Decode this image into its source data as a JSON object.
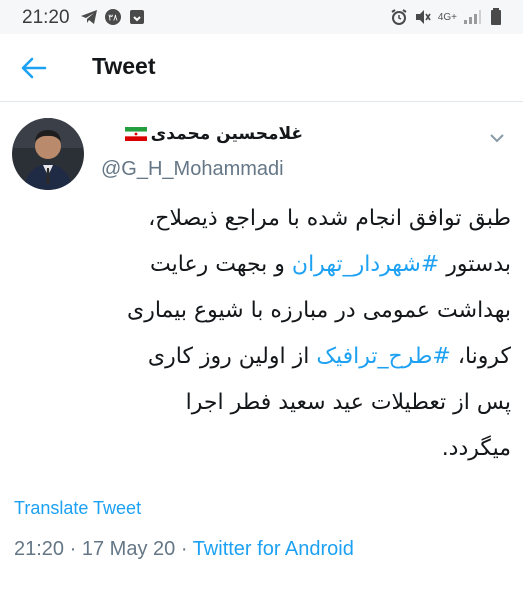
{
  "status_bar": {
    "time": "21:20",
    "network_label": "4G+",
    "left_icons": [
      "telegram-icon",
      "notification-badge-icon",
      "download-icon"
    ],
    "right_icons": [
      "alarm-icon",
      "mute-icon",
      "network-icon",
      "signal-icon",
      "battery-icon"
    ]
  },
  "header": {
    "back_icon": "arrow-left-icon",
    "title": "Tweet"
  },
  "tweet": {
    "author": {
      "display_name": "غلامحسین محمدی",
      "handle": "@G_H_Mohammadi",
      "flag_icon": "iran-flag-icon"
    },
    "text": {
      "line1": "طبق توافق انجام شده با مراجع ذیصلاح،",
      "line2_before": "بدستور ",
      "line2_hashtag": "#شهردار_تهران",
      "line2_after": " و بجهت رعایت",
      "line3": "بهداشت عمومی در مبارزه با شیوع بیماری",
      "line4_before": "کرونا، ",
      "line4_hashtag": "#طرح_ترافیک",
      "line4_after": " از اولین روز کاری",
      "line5": "پس از تعطیلات عید سعید فطر اجرا",
      "line6": "میگردد."
    },
    "translate_label": "Translate Tweet",
    "time": "21:20",
    "separator": "·",
    "date": "17 May 20",
    "source": "Twitter for Android"
  },
  "colors": {
    "accent": "#1da1f2",
    "text": "#14171a",
    "secondary": "#657786"
  }
}
